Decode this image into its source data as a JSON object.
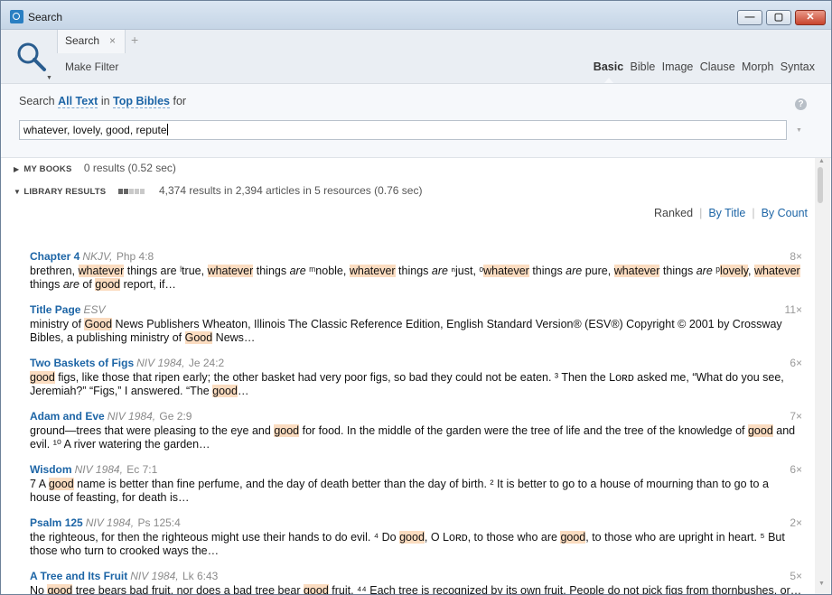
{
  "window": {
    "title": "Search",
    "minimize": "—",
    "maximize": "▢",
    "close": "✕"
  },
  "toolbar": {
    "tab_label": "Search",
    "tab_close": "×",
    "tab_add": "+",
    "make_filter": "Make Filter",
    "modes": [
      "Basic",
      "Bible",
      "Image",
      "Clause",
      "Morph",
      "Syntax"
    ],
    "active_mode": "Basic"
  },
  "search": {
    "prefix": "Search",
    "scope": "All Text",
    "in_word": "in",
    "collection": "Top Bibles",
    "suffix": "for",
    "query": "whatever, lovely, good, repute",
    "help": "?"
  },
  "sections": {
    "my_books": {
      "label": "MY BOOKS",
      "summary": "0 results (0.52 sec)"
    },
    "library": {
      "label": "LIBRARY RESULTS",
      "summary": "4,374 results in 2,394 articles in 5 resources (0.76 sec)",
      "progress": 0.4
    }
  },
  "sort": {
    "options": [
      "Ranked",
      "By Title",
      "By Count"
    ],
    "active": "Ranked"
  },
  "results": [
    {
      "title": "Chapter 4",
      "version": "NKJV,",
      "ref": "Php 4:8",
      "count": "8×",
      "segments": [
        [
          "brethren, ",
          false
        ],
        [
          "whatever",
          true
        ],
        [
          " things are ˡtrue, ",
          false
        ],
        [
          "whatever",
          true
        ],
        [
          " things ",
          false
        ],
        [
          "are",
          "i"
        ],
        [
          " ᵐnoble, ",
          false
        ],
        [
          "whatever",
          true
        ],
        [
          " things ",
          false
        ],
        [
          "are",
          "i"
        ],
        [
          " ⁿjust, ᵒ",
          false
        ],
        [
          "whatever",
          true
        ],
        [
          " things ",
          false
        ],
        [
          "are",
          "i"
        ],
        [
          " pure, ",
          false
        ],
        [
          "whatever",
          true
        ],
        [
          " things ",
          false
        ],
        [
          "are",
          "i"
        ],
        [
          " ᵖ",
          false
        ],
        [
          "lovely",
          true
        ],
        [
          ", ",
          false
        ],
        [
          "whatever",
          true
        ],
        [
          " things ",
          false
        ],
        [
          "are",
          "i"
        ],
        [
          " of ",
          false
        ],
        [
          "good",
          true
        ],
        [
          " report, if…",
          false
        ]
      ]
    },
    {
      "title": "Title Page",
      "version": "ESV",
      "ref": "",
      "count": "11×",
      "segments": [
        [
          "ministry of ",
          false
        ],
        [
          "Good",
          true
        ],
        [
          " News Publishers Wheaton, Illinois The Classic Reference Edition, English Standard Version® (ESV®) Copyright © 2001 by Crossway Bibles, a publishing ministry of ",
          false
        ],
        [
          "Good",
          true
        ],
        [
          " News…",
          false
        ]
      ]
    },
    {
      "title": "Two Baskets of Figs",
      "version": "NIV 1984,",
      "ref": "Je 24:2",
      "count": "6×",
      "segments": [
        [
          "good",
          true
        ],
        [
          " figs, like those that ripen early; the other basket had very poor figs, so bad they could not be eaten. ³ Then the Lᴏʀᴅ asked me, “What do you see, Jeremiah?” “Figs,” I answered. “The ",
          false
        ],
        [
          "good",
          true
        ],
        [
          "…",
          false
        ]
      ]
    },
    {
      "title": "Adam and Eve",
      "version": "NIV 1984,",
      "ref": "Ge 2:9",
      "count": "7×",
      "segments": [
        [
          "ground—trees that were pleasing to the eye and ",
          false
        ],
        [
          "good",
          true
        ],
        [
          " for food. In the middle of the garden were the tree of life and the tree of the knowledge of ",
          false
        ],
        [
          "good",
          true
        ],
        [
          " and evil. ¹⁰ A river watering the garden…",
          false
        ]
      ]
    },
    {
      "title": "Wisdom",
      "version": "NIV 1984,",
      "ref": "Ec 7:1",
      "count": "6×",
      "segments": [
        [
          "7    A ",
          false
        ],
        [
          "good",
          true
        ],
        [
          " name is better than fine perfume, and the day of death better than the day of birth. ²     It is better to go to a house of mourning than to go to a house of feasting, for death is…",
          false
        ]
      ]
    },
    {
      "title": "Psalm 125",
      "version": "NIV 1984,",
      "ref": "Ps 125:4",
      "count": "2×",
      "segments": [
        [
          "the righteous, for then the righteous might use their hands to do evil. ⁴     Do ",
          false
        ],
        [
          "good",
          true
        ],
        [
          ", O Lᴏʀᴅ, to those who are ",
          false
        ],
        [
          "good",
          true
        ],
        [
          ", to those who are upright in heart. ⁵     But those who turn to crooked ways the…",
          false
        ]
      ]
    },
    {
      "title": "A Tree and Its Fruit",
      "version": "NIV 1984,",
      "ref": "Lk 6:43",
      "count": "5×",
      "segments": [
        [
          "No ",
          false
        ],
        [
          "good",
          true
        ],
        [
          " tree bears bad fruit, nor does a bad tree bear ",
          false
        ],
        [
          "good",
          true
        ],
        [
          " fruit. ⁴⁴ Each tree is recognized by its own fruit. People do not pick figs from thornbushes, or…",
          false
        ]
      ]
    }
  ]
}
